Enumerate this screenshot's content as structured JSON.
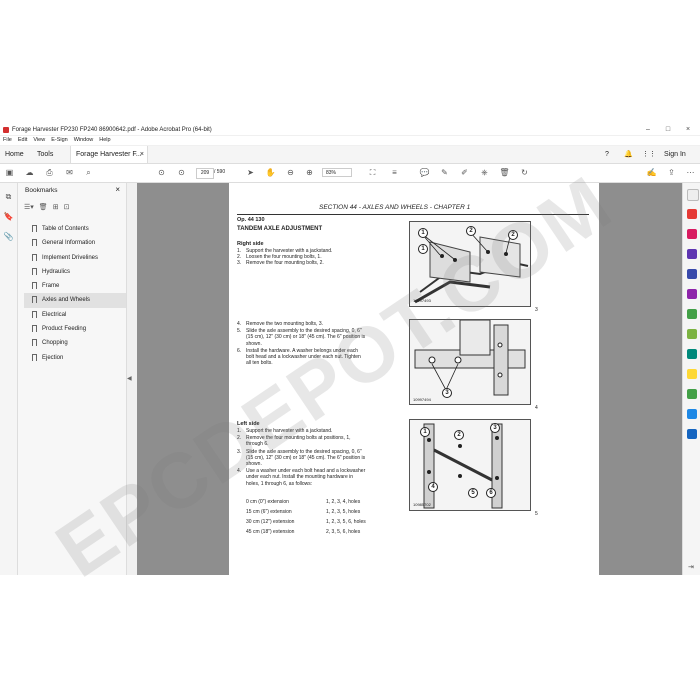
{
  "window": {
    "title": "Forage Harvester FP230 FP240 86900642.pdf - Adobe Acrobat Pro (64-bit)",
    "controls": [
      "–",
      "□",
      "×"
    ]
  },
  "menu": [
    "File",
    "Edit",
    "View",
    "E-Sign",
    "Window",
    "Help"
  ],
  "tabs": {
    "home": "Home",
    "tools": "Tools",
    "document": "Forage Harvester F...",
    "sign_in": "Sign In"
  },
  "toolbar": {
    "page_current": "209",
    "page_total": "/ 590",
    "zoom": "83%"
  },
  "bookmarks": {
    "header": "Bookmarks",
    "items": [
      {
        "label": "Table of Contents"
      },
      {
        "label": "General Information"
      },
      {
        "label": "Implement Drivelines"
      },
      {
        "label": "Hydraulics"
      },
      {
        "label": "Frame"
      },
      {
        "label": "Axles and Wheels"
      },
      {
        "label": "Electrical"
      },
      {
        "label": "Product Feeding"
      },
      {
        "label": "Chopping"
      },
      {
        "label": "Ejection"
      }
    ],
    "active_index": 5
  },
  "document": {
    "section_title": "SECTION 44 - AXLES AND WHEELS - CHAPTER 1",
    "op_code": "Op. 44 130",
    "heading": "TANDEM AXLE ADJUSTMENT",
    "right_side_label": "Right side",
    "right_steps": [
      {
        "n": "1.",
        "t": "Support the harvester with a jackstand."
      },
      {
        "n": "2.",
        "t": "Loosen the four mounting bolts, 1."
      },
      {
        "n": "3.",
        "t": "Remove the four mounting bolts, 2."
      }
    ],
    "right_steps2": [
      {
        "n": "4.",
        "t": "Remove the two mounting bolts, 3."
      },
      {
        "n": "5.",
        "t": "Slide the axle assembly to the desired spacing, 0, 6\" (15 cm), 12\" (30 cm) or 18\" (45 cm). The 6\" position is shown."
      },
      {
        "n": "6.",
        "t": "Install the hardware. A washer belongs under each bolt head and a lockwasher under each nut. Tighten all ten bolts."
      }
    ],
    "left_side_label": "Left side",
    "left_steps": [
      {
        "n": "1.",
        "t": "Support the harvester with a jackstand."
      },
      {
        "n": "2.",
        "t": "Remove the four mounting bolts at positions, 1, through 6."
      },
      {
        "n": "3.",
        "t": "Slide the axle assembly to the desired spacing, 0, 6\" (15 cm), 12\" (30 cm) or 18\" (45 cm). The 6\" position is shown."
      },
      {
        "n": "4.",
        "t": "Use a washer under each bolt head and a lockwasher under each nut. Install the mounting hardware in holes, 1 through 6, as follows:"
      }
    ],
    "extension_table": [
      {
        "ext": "0 cm (0\") extension",
        "holes": "1, 2, 3, 4, holes"
      },
      {
        "ext": "15 cm (6\") extension",
        "holes": "1, 2, 3, 5, holes"
      },
      {
        "ext": "30 cm (12\") extension",
        "holes": "1, 2, 3, 5, 6, holes"
      },
      {
        "ext": "45 cm (18\") extension",
        "holes": "2, 3, 5, 6, holes"
      }
    ],
    "figures": [
      {
        "code": "10997493",
        "number": "3",
        "callouts": [
          "1",
          "2",
          "1",
          "2"
        ]
      },
      {
        "code": "10997494",
        "number": "4",
        "callouts": [
          "3"
        ]
      },
      {
        "code": "10985702",
        "number": "5",
        "callouts": [
          "1",
          "2",
          "3",
          "4",
          "5",
          "6"
        ]
      }
    ],
    "watermark": "EPCDEPOT.COM"
  }
}
